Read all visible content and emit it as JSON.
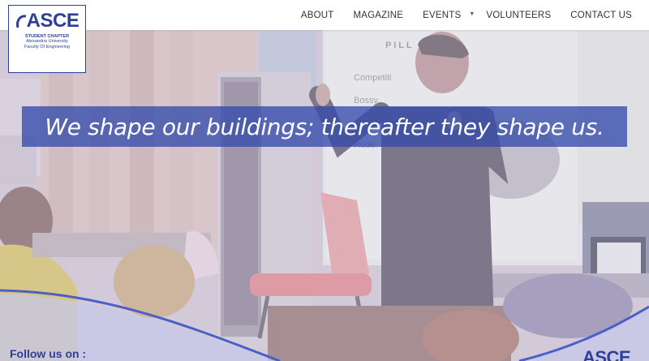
{
  "logo": {
    "title": "ASCE",
    "subtitle_strong": "STUDENT CHAPTER",
    "subtitle_line1": "Alexandria University",
    "subtitle_line2": "Faculty Of Engineering"
  },
  "nav": {
    "items": [
      "ABOUT",
      "MAGAZINE",
      "EVENTS",
      "VOLUNTEERS",
      "CONTACT US"
    ],
    "events_caret": "▼"
  },
  "hero": {
    "tagline": "We shape our buildings; thereafter they shape us.",
    "slide_heading": "P   I L L",
    "slide_bullets": [
      "Competiti",
      "Bossy.",
      "Rude."
    ]
  },
  "footer": {
    "follow_label": "Follow us on :",
    "brand": "ASCE"
  },
  "colors": {
    "brand_blue": "#2d3f97",
    "tagline_band": "#344aaa",
    "nav_text": "#333333"
  }
}
